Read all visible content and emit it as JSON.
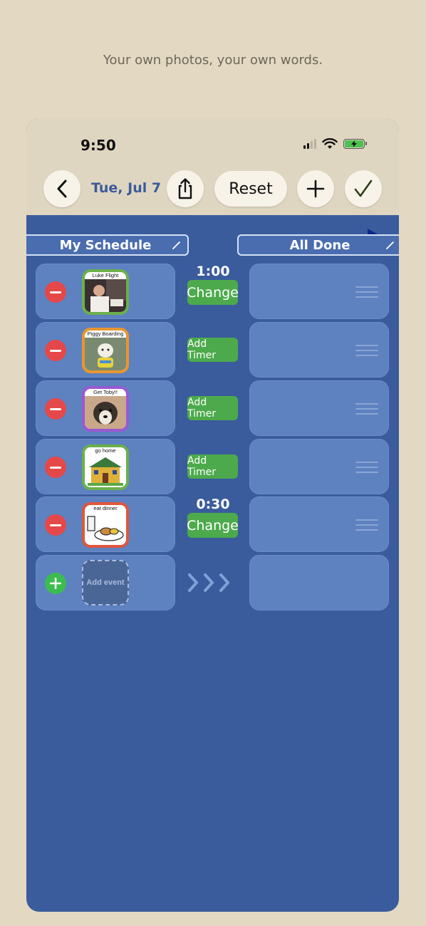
{
  "tagline": "Your own photos, your own words.",
  "status": {
    "time": "9:50"
  },
  "toolbar": {
    "date": "Tue, Jul 7",
    "reset_label": "Reset"
  },
  "columns": {
    "left_title": "My Schedule",
    "right_title": "All Done"
  },
  "events": [
    {
      "label": "Luke Flight",
      "timer": "1:00",
      "action": "Change",
      "border": "#6ab04c"
    },
    {
      "label": "Piggy Boarding",
      "timer": "",
      "action": "Add Timer",
      "border": "#e8962f"
    },
    {
      "label": "Get Toby!!",
      "timer": "",
      "action": "Add Timer",
      "border": "#9b59d0"
    },
    {
      "label": "go home",
      "timer": "",
      "action": "Add Timer",
      "border": "#6ab04c"
    },
    {
      "label": "eat dinner",
      "timer": "0:30",
      "action": "Change",
      "border": "#e0553b"
    }
  ],
  "add_event": {
    "label": "Add event"
  },
  "colors": {
    "background": "#e3d9c2",
    "board": "#3a5c9c",
    "card": "#5e81c0",
    "green": "#4caa4c",
    "red": "#e54848",
    "date_text": "#3b5b9a"
  }
}
